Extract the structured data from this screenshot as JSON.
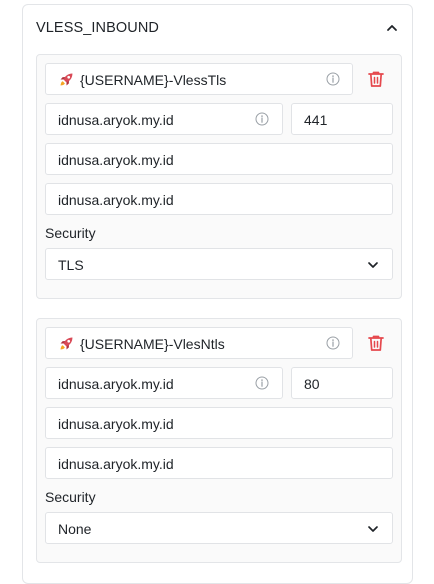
{
  "section": {
    "title": "VLESS_INBOUND"
  },
  "cards": [
    {
      "name": "{USERNAME}-VlessTls",
      "address": "idnusa.aryok.my.id",
      "port": "441",
      "host": "idnusa.aryok.my.id",
      "sni": "idnusa.aryok.my.id",
      "security_label": "Security",
      "security_value": "TLS"
    },
    {
      "name": "{USERNAME}-VlesNtls",
      "address": "idnusa.aryok.my.id",
      "port": "80",
      "host": "idnusa.aryok.my.id",
      "sni": "idnusa.aryok.my.id",
      "security_label": "Security",
      "security_value": "None"
    }
  ],
  "icons": {
    "rocket": "rocket-icon",
    "info": "info-icon",
    "delete": "trash-icon",
    "collapse": "chevron-up-icon",
    "dropdown": "chevron-down-icon"
  },
  "colors": {
    "delete_red": "#e5484d",
    "border": "#e3e5e8",
    "icon_gray": "#9aa0a6"
  }
}
